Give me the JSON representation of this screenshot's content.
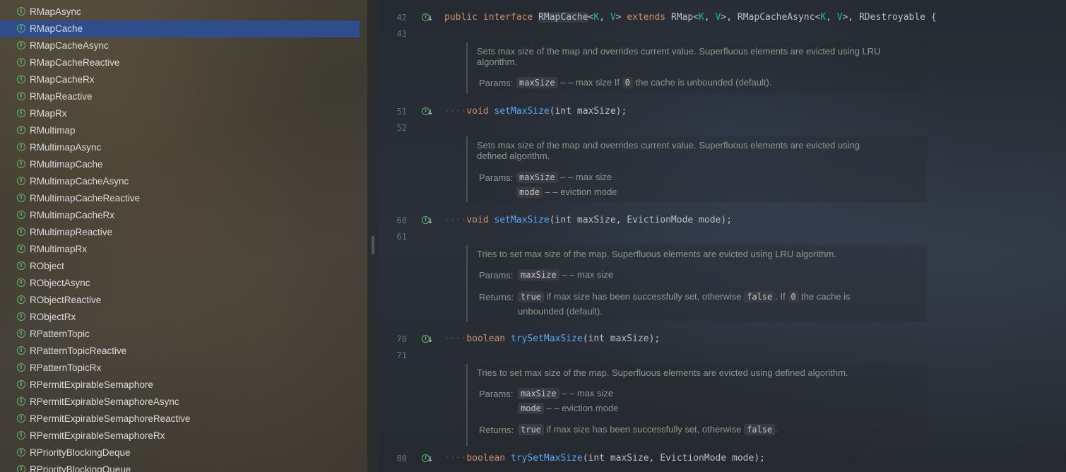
{
  "sidebar": {
    "items": [
      {
        "label": "RMapAsync",
        "selected": false
      },
      {
        "label": "RMapCache",
        "selected": true
      },
      {
        "label": "RMapCacheAsync",
        "selected": false
      },
      {
        "label": "RMapCacheReactive",
        "selected": false
      },
      {
        "label": "RMapCacheRx",
        "selected": false
      },
      {
        "label": "RMapReactive",
        "selected": false
      },
      {
        "label": "RMapRx",
        "selected": false
      },
      {
        "label": "RMultimap",
        "selected": false
      },
      {
        "label": "RMultimapAsync",
        "selected": false
      },
      {
        "label": "RMultimapCache",
        "selected": false
      },
      {
        "label": "RMultimapCacheAsync",
        "selected": false
      },
      {
        "label": "RMultimapCacheReactive",
        "selected": false
      },
      {
        "label": "RMultimapCacheRx",
        "selected": false
      },
      {
        "label": "RMultimapReactive",
        "selected": false
      },
      {
        "label": "RMultimapRx",
        "selected": false
      },
      {
        "label": "RObject",
        "selected": false
      },
      {
        "label": "RObjectAsync",
        "selected": false
      },
      {
        "label": "RObjectReactive",
        "selected": false
      },
      {
        "label": "RObjectRx",
        "selected": false
      },
      {
        "label": "RPatternTopic",
        "selected": false
      },
      {
        "label": "RPatternTopicReactive",
        "selected": false
      },
      {
        "label": "RPatternTopicRx",
        "selected": false
      },
      {
        "label": "RPermitExpirableSemaphore",
        "selected": false
      },
      {
        "label": "RPermitExpirableSemaphoreAsync",
        "selected": false
      },
      {
        "label": "RPermitExpirableSemaphoreReactive",
        "selected": false
      },
      {
        "label": "RPermitExpirableSemaphoreRx",
        "selected": false
      },
      {
        "label": "RPriorityBlockingDeque",
        "selected": false
      },
      {
        "label": "RPriorityBlockingQueue",
        "selected": false
      }
    ],
    "icon_glyph": "I",
    "icon_name": "interface-icon"
  },
  "editor": {
    "line_numbers": {
      "l42": "42",
      "l43": "43",
      "l51": "51",
      "l52": "52",
      "l60": "60",
      "l61": "61",
      "l70": "70",
      "l71": "71",
      "l80": "80"
    },
    "code": {
      "l42": {
        "kw1": "public",
        "kw2": "interface",
        "name": "RMapCache",
        "lt": "<",
        "K": "K",
        "comma": ", ",
        "V": "V",
        "gt": ">",
        "kw3": "extends",
        "rmap": "RMap<",
        "K2": "K",
        "c2": ", ",
        "V2": "V",
        "g2": ">, ",
        "async": "RMapCacheAsync<",
        "K3": "K",
        "c3": ", ",
        "V3": "V",
        "g3": ">, ",
        "destroy": "RDestroyable",
        "brace": " {"
      },
      "l51": {
        "ret": "void",
        "fn": "setMaxSize",
        "params": "(int maxSize);"
      },
      "l60": {
        "ret": "void",
        "fn": "setMaxSize",
        "params": "(int maxSize, EvictionMode mode);"
      },
      "l70": {
        "ret": "boolean",
        "fn": "trySetMaxSize",
        "params": "(int maxSize);"
      },
      "l80": {
        "ret": "boolean",
        "fn": "trySetMaxSize",
        "params": "(int maxSize, EvictionMode mode);"
      },
      "indent_dots": "····"
    },
    "docs": {
      "d1": {
        "line1": "Sets max size of the map and overrides current value. Superfluous elements are evicted using LRU",
        "line2": "algorithm.",
        "params_label": "Params:",
        "p1_name": "maxSize",
        "p1_pre": " – – max size If ",
        "p1_zero": "0",
        "p1_post": " the cache is unbounded (default)."
      },
      "d2": {
        "line1": "Sets max size of the map and overrides current value. Superfluous elements are evicted using",
        "line2": "defined algorithm.",
        "params_label": "Params:",
        "p1_name": "maxSize",
        "p1_desc": " – – max size",
        "p2_name": "mode",
        "p2_desc": " – – eviction mode"
      },
      "d3": {
        "line1": "Tries to set max size of the map. Superfluous elements are evicted using LRU algorithm.",
        "params_label": "Params:",
        "p1_name": "maxSize",
        "p1_desc": " – – max size",
        "returns_label": "Returns:",
        "r_true": "true",
        "r_mid": " if max size has been successfully set, otherwise ",
        "r_false": "false",
        "r_mid2": ". If ",
        "r_zero": "0",
        "r_post": " the cache is",
        "r_line2": "unbounded (default)."
      },
      "d4": {
        "line1": "Tries to set max size of the map. Superfluous elements are evicted using defined algorithm.",
        "params_label": "Params:",
        "p1_name": "maxSize",
        "p1_desc": " – – max size",
        "p2_name": "mode",
        "p2_desc": " – – eviction mode",
        "returns_label": "Returns:",
        "r_true": "true",
        "r_mid": " if max size has been successfully set, otherwise ",
        "r_false": "false",
        "r_post": "."
      }
    },
    "gutter_glyph": "I",
    "gutter_arrow": "↓",
    "gutter_icon_name": "implemented-icon"
  },
  "colors": {
    "selection": "#2f4d8c",
    "keyword": "#cf8e6d",
    "type_param": "#16baac",
    "method": "#56a8f5",
    "doc_text": "#8a9a8e",
    "icon_green": "#5fb86a"
  }
}
